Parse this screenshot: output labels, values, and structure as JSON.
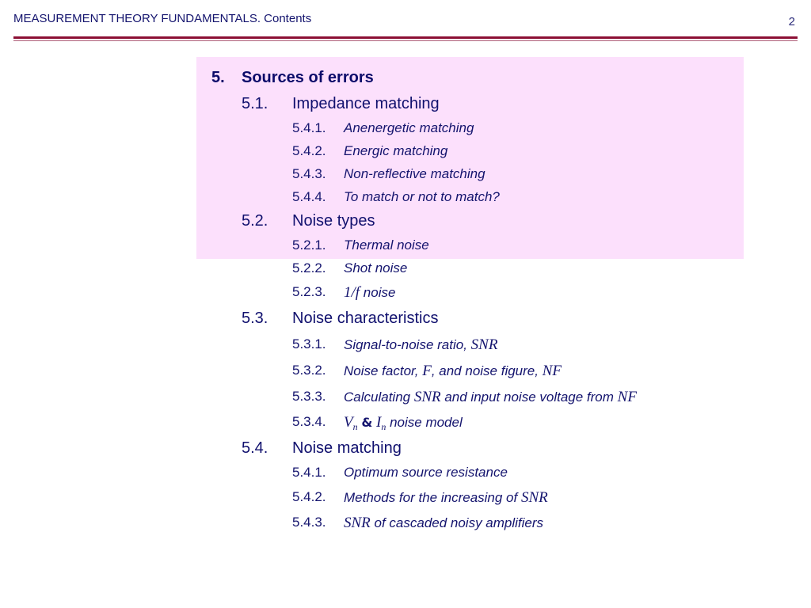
{
  "header": {
    "title": "MEASUREMENT THEORY FUNDAMENTALS. Contents",
    "page_number": "2",
    "rule_color": "#8c1035",
    "highlight_color": "#fce0fc",
    "text_color": "#10106e"
  },
  "toc": {
    "chapter": {
      "num": "5.",
      "title": "Sources of errors"
    },
    "sections": [
      {
        "num": "5.1.",
        "title": "Impedance matching",
        "subsections": [
          {
            "num": "5.4.1.",
            "title": "Anenergetic matching"
          },
          {
            "num": "5.4.2.",
            "title": "Energic matching"
          },
          {
            "num": "5.4.3.",
            "title": "Non-reflective matching"
          },
          {
            "num": "5.4.4.",
            "title": "To match or not to match?"
          }
        ]
      },
      {
        "num": "5.2.",
        "title": "Noise types",
        "subsections": [
          {
            "num": "5.2.1.",
            "title": "Thermal noise"
          },
          {
            "num": "5.2.2.",
            "title": "Shot noise"
          },
          {
            "num": "5.2.3.",
            "title_math": "1/f",
            "title_rest": " noise"
          }
        ]
      },
      {
        "num": "5.3.",
        "title": "Noise characteristics",
        "subsections": [
          {
            "num": "5.3.1.",
            "title": "Signal-to-noise ratio, ",
            "math": "SNR"
          },
          {
            "num": "5.3.2.",
            "t1": "Noise factor, ",
            "m1": "F",
            "t2": ", and noise figure, ",
            "m2": "NF"
          },
          {
            "num": "5.3.3.",
            "t1": "Calculating ",
            "m1": "SNR",
            "t2": " and input noise voltage from ",
            "m2": "NF"
          },
          {
            "num": "5.3.4.",
            "v": "V",
            "v_sub": "n",
            "amp": "&",
            "i": "I",
            "i_sub": "n",
            "rest": " noise model"
          }
        ]
      },
      {
        "num": "5.4.",
        "title": "Noise matching",
        "subsections": [
          {
            "num": "5.4.1.",
            "title": "Optimum source resistance"
          },
          {
            "num": "5.4.2.",
            "title": "Methods for the increasing of ",
            "math": "SNR"
          },
          {
            "num": "5.4.3.",
            "math": "SNR",
            "title": " of cascaded noisy amplifiers"
          }
        ]
      }
    ]
  }
}
